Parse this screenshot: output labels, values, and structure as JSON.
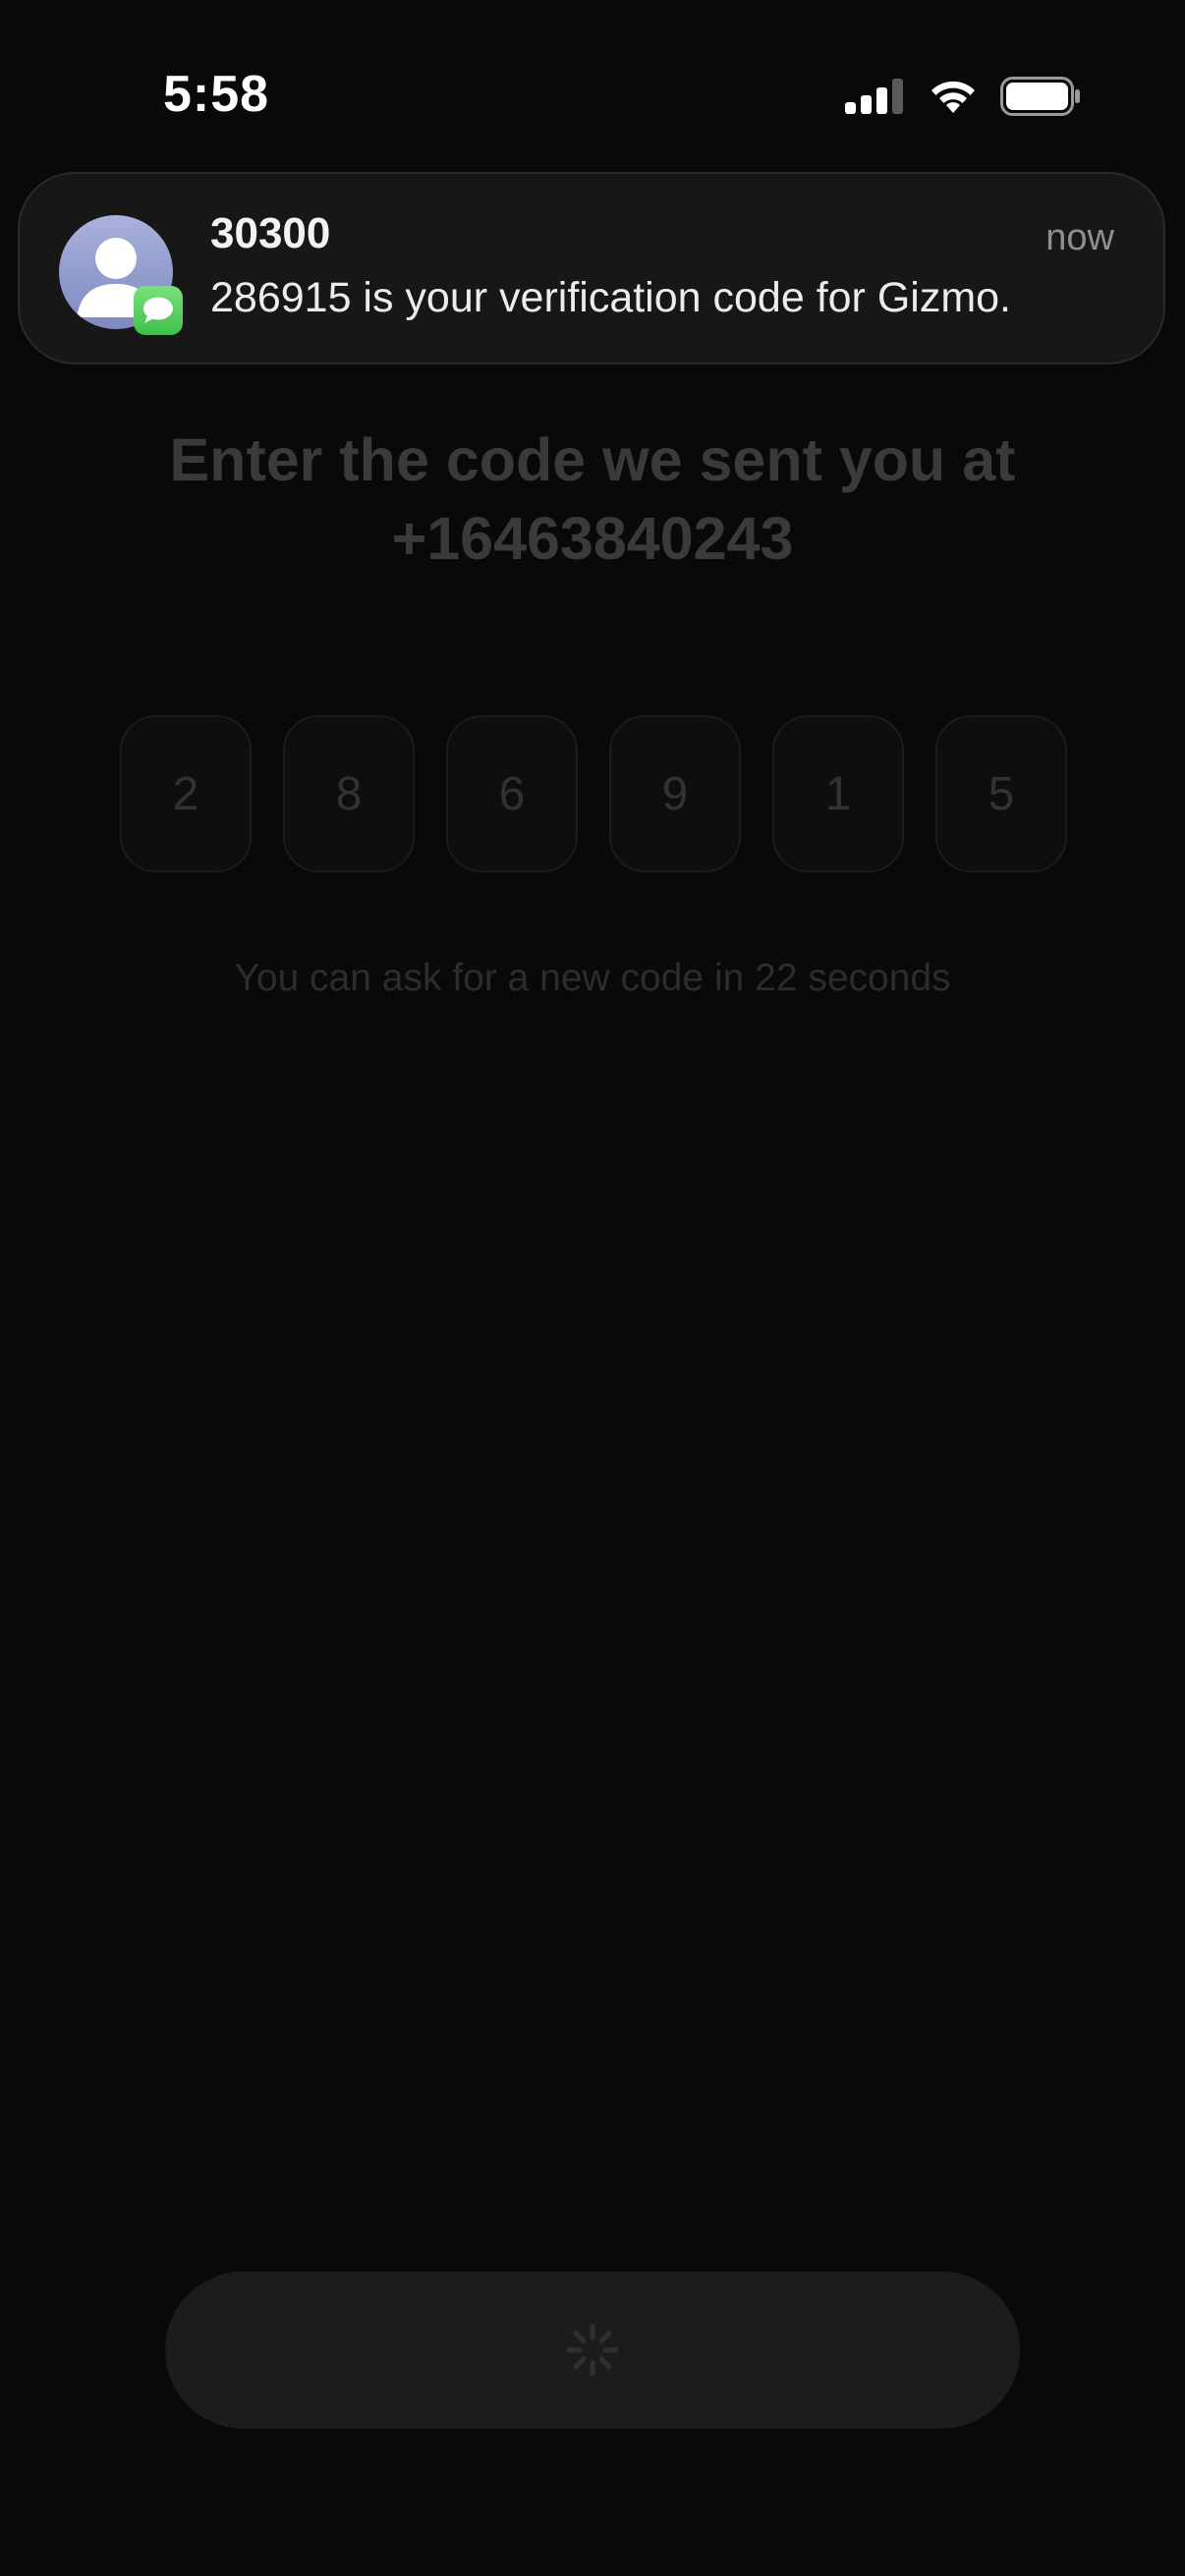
{
  "status_bar": {
    "time": "5:58",
    "icons": [
      "cellular-signal-icon",
      "wifi-icon",
      "battery-icon"
    ]
  },
  "notification": {
    "sender": "30300",
    "time": "now",
    "message": "286915 is your verification code for Gizmo.",
    "avatar_icon": "contact-avatar-icon",
    "app_icon": "messages-icon"
  },
  "verification": {
    "heading_line1": "Enter the code we sent you at",
    "heading_line2": "+16463840243",
    "code_digits": [
      "2",
      "8",
      "6",
      "9",
      "1",
      "5"
    ],
    "resend_text": "You can ask for a new code in 22 seconds"
  },
  "submit_button": {
    "state_icon": "loading-spinner-icon"
  },
  "colors": {
    "background": "#090909",
    "notification_bg": "#171717",
    "messages_green": "#4cd964",
    "avatar_blue": "#8f99cc"
  }
}
